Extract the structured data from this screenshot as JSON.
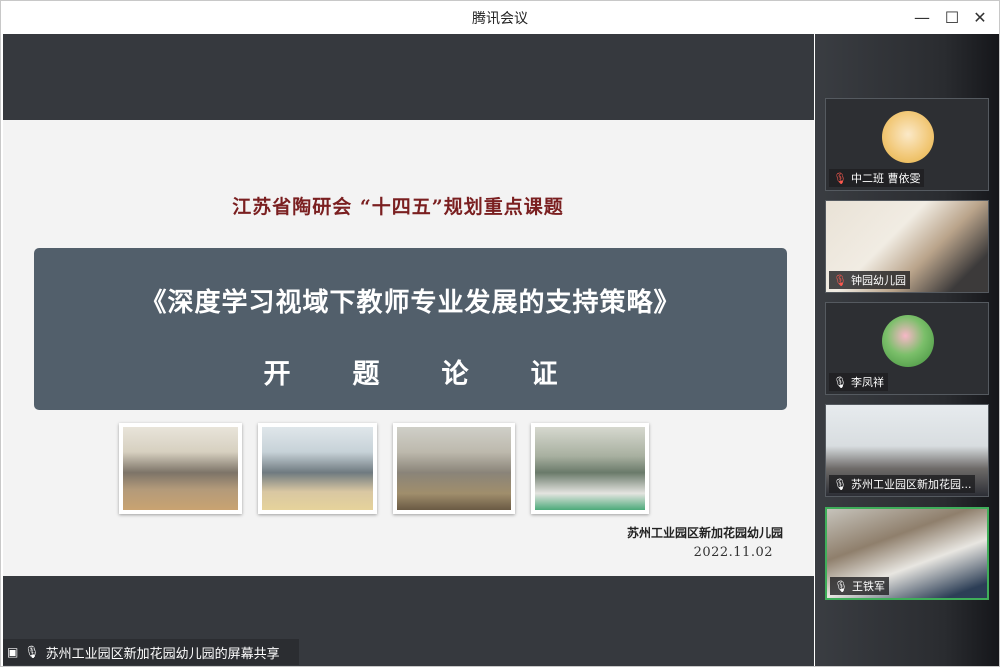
{
  "window": {
    "title": "腾讯会议",
    "minimize": "—",
    "maximize": "☐",
    "close": "✕"
  },
  "slide": {
    "subtitle": "江苏省陶研会 “十四五”规划重点课题",
    "main_title": "《深度学习视域下教师专业发展的支持策略》",
    "sub_title": "开题论证",
    "organization": "苏州工业园区新加花园幼儿园",
    "date": "2022.11.02"
  },
  "share": {
    "label": "苏州工业园区新加花园幼儿园的屏幕共享",
    "icon": "screen-share-icon"
  },
  "participants": [
    {
      "name": "中二班 曹依雯",
      "mic": "muted",
      "view": "avatar"
    },
    {
      "name": "钟园幼儿园",
      "mic": "muted",
      "view": "video"
    },
    {
      "name": "李凤祥",
      "mic": "on",
      "view": "avatar"
    },
    {
      "name": "苏州工业园区新加花园...",
      "mic": "on",
      "view": "video"
    },
    {
      "name": "王铁军",
      "mic": "on",
      "view": "video",
      "speaking": true
    }
  ],
  "colors": {
    "accent_speaking": "#3fae5a",
    "slide_title_bg": "#525f6b",
    "slide_subtitle": "#7a1f20"
  }
}
